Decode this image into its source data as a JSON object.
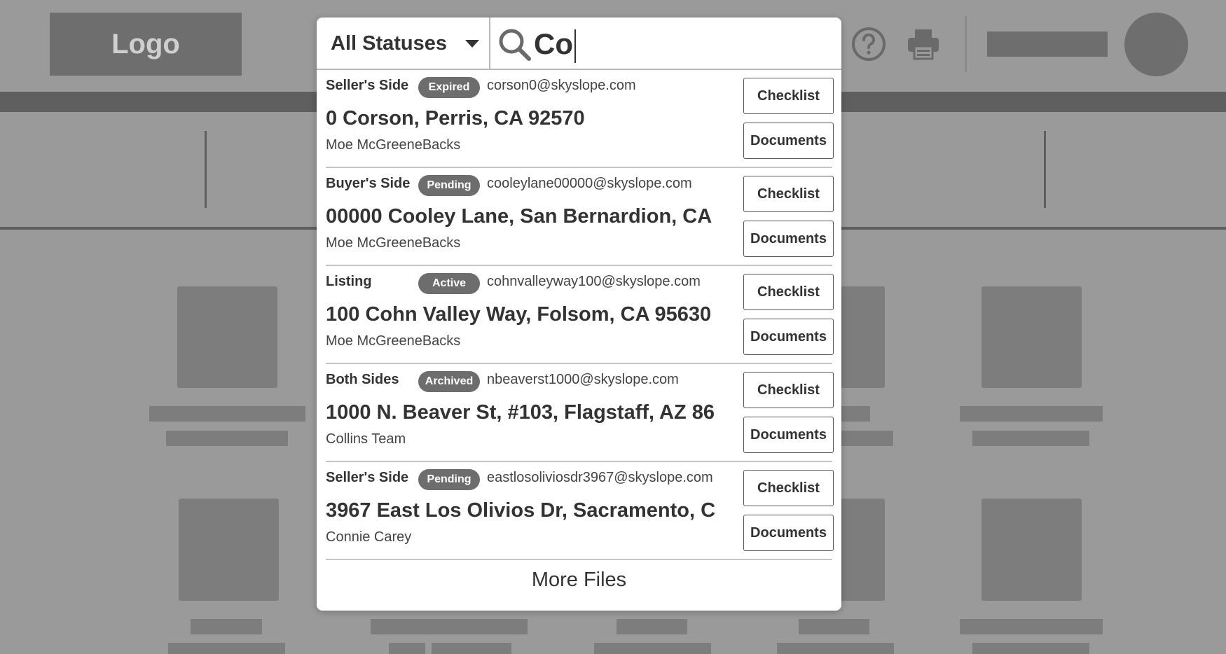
{
  "header": {
    "logo_text": "Logo",
    "icons": [
      "help-icon",
      "print-icon"
    ]
  },
  "search": {
    "status_filter": "All Statuses",
    "query": "Co"
  },
  "results": [
    {
      "side": "Seller's Side",
      "status": "Expired",
      "email": "corson0@skyslope.com",
      "address": "0 Corson, Perris, CA 92570",
      "agent": "Moe McGreeneBacks",
      "checklist_label": "Checklist",
      "documents_label": "Documents"
    },
    {
      "side": "Buyer's Side",
      "status": "Pending",
      "email": "cooleylane00000@skyslope.com",
      "address": "00000 Cooley Lane, San Bernardion, CA",
      "agent": "Moe McGreeneBacks",
      "checklist_label": "Checklist",
      "documents_label": "Documents"
    },
    {
      "side": "Listing",
      "status": "Active",
      "email": "cohnvalleyway100@skyslope.com",
      "address": "100 Cohn Valley Way, Folsom, CA 95630",
      "agent": "Moe McGreeneBacks",
      "checklist_label": "Checklist",
      "documents_label": "Documents"
    },
    {
      "side": "Both Sides",
      "status": "Archived",
      "email": "nbeaverst1000@skyslope.com",
      "address": "1000 N. Beaver St, #103, Flagstaff, AZ 86",
      "agent": "Collins Team",
      "checklist_label": "Checklist",
      "documents_label": "Documents"
    },
    {
      "side": "Seller's Side",
      "status": "Pending",
      "email": "eastlosoliviosdr3967@skyslope.com",
      "address": "3967 East Los Olivios Dr, Sacramento, C",
      "agent": "Connie Carey",
      "checklist_label": "Checklist",
      "documents_label": "Documents"
    }
  ],
  "more_files_label": "More Files",
  "colors": {
    "overlay_background": "#9a9a9a",
    "placeholder_block": "#7d7d7d",
    "badge": "#6d6d6d",
    "panel": "#ffffff"
  }
}
